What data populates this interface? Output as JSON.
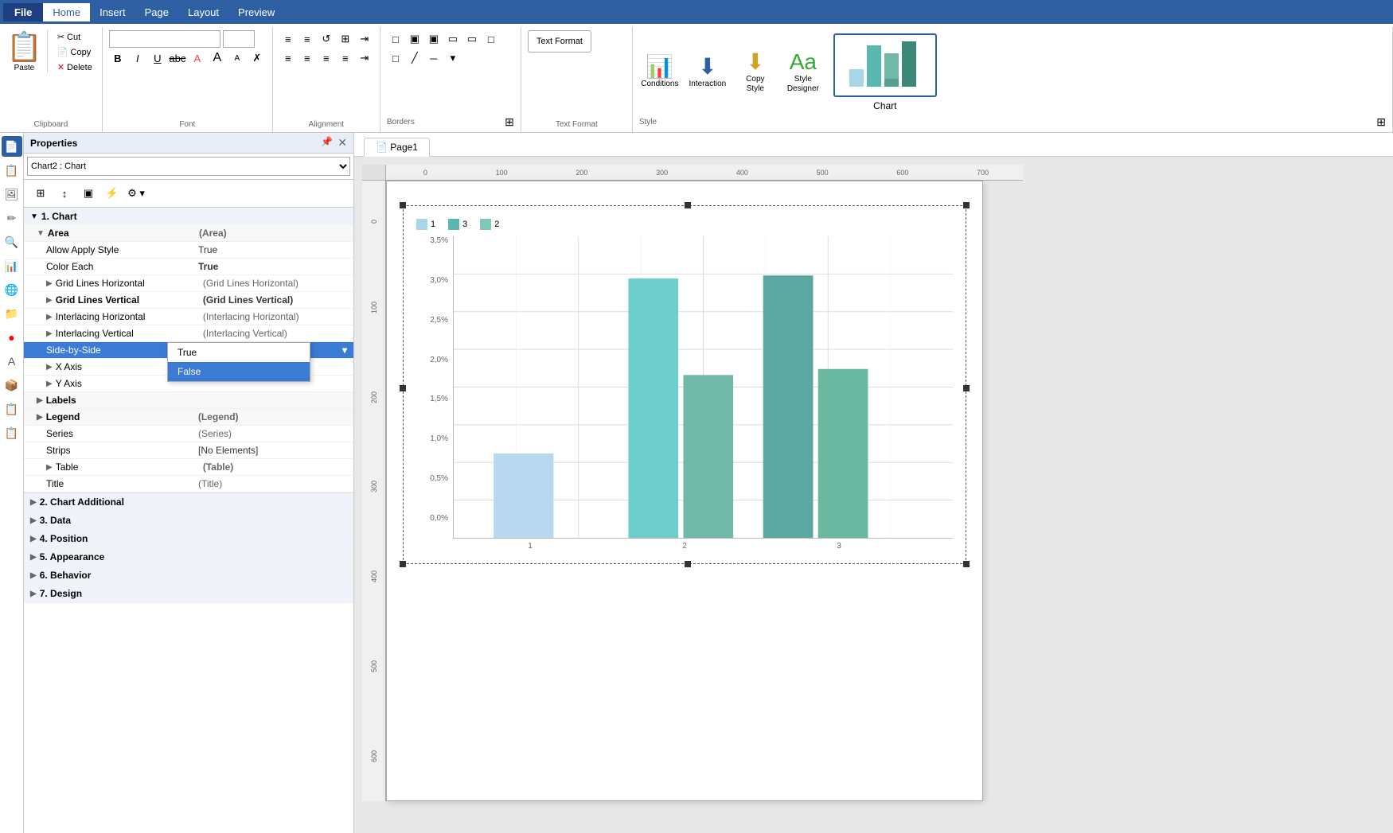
{
  "menu": {
    "file_label": "File",
    "items": [
      "Home",
      "Insert",
      "Page",
      "Layout",
      "Preview"
    ],
    "active": "Home"
  },
  "ribbon": {
    "clipboard": {
      "label": "Clipboard",
      "paste": "Paste",
      "cut": "Cut",
      "copy": "Copy",
      "delete": "Delete"
    },
    "font": {
      "label": "Font",
      "font_name": "",
      "font_size": "",
      "bold": "B",
      "italic": "I",
      "underline": "U",
      "strikethrough": "abc",
      "font_color": "A",
      "grow": "A",
      "shrink": "A",
      "clear": "✗"
    },
    "alignment": {
      "label": "Alignment",
      "expand_icon": "⊞"
    },
    "borders": {
      "label": "Borders",
      "text_format_btn": "Text Format",
      "expand_icon": "⊞"
    },
    "text_format": {
      "label": "Text Format",
      "btn": "Text Format"
    },
    "style": {
      "label": "Style",
      "conditions": "Conditions",
      "interaction": "Interaction",
      "copy_style": "Copy\nStyle",
      "style_designer": "Style\nDesigner",
      "expand_icon": "⊞"
    },
    "chart": {
      "label": "Chart"
    }
  },
  "properties": {
    "panel_title": "Properties",
    "selector_value": "Chart2 : Chart",
    "tree": {
      "section1": "1. Chart",
      "area_label": "Area",
      "area_value": "(Area)",
      "allow_apply_style_key": "Allow Apply Style",
      "allow_apply_style_val": "True",
      "color_each_key": "Color Each",
      "color_each_val": "True",
      "grid_lines_h_key": "Grid Lines Horizontal",
      "grid_lines_h_val": "(Grid Lines Horizontal)",
      "grid_lines_v_key": "Grid Lines Vertical",
      "grid_lines_v_val": "(Grid Lines Vertical)",
      "interlacing_h_key": "Interlacing Horizontal",
      "interlacing_h_val": "(Interlacing Horizontal)",
      "interlacing_v_key": "Interlacing Vertical",
      "interlacing_v_val": "(Interlacing Vertical)",
      "side_by_side_key": "Side-by-Side",
      "side_by_side_val": "False",
      "x_axis_key": "X Axis",
      "x_axis_val": "",
      "y_axis_key": "Y Axis",
      "y_axis_val": "",
      "labels_key": "Labels",
      "labels_val": "",
      "legend_key": "Legend",
      "legend_val": "(Legend)",
      "series_key": "Series",
      "series_val": "(Series)",
      "strips_key": "Strips",
      "strips_val": "[No Elements]",
      "table_key": "Table",
      "table_val": "(Table)",
      "title_key": "Title",
      "title_val": "(Title)",
      "section2": "2. Chart Additional",
      "section3": "3. Data",
      "section4": "4. Position",
      "section5": "5. Appearance",
      "section6": "6. Behavior",
      "section7": "7. Design"
    },
    "dropdown": {
      "true_option": "True",
      "false_option": "False",
      "selected": "False"
    }
  },
  "canvas": {
    "tab": "Page1",
    "ruler": {
      "h_ticks": [
        "100",
        "200",
        "300",
        "400",
        "500",
        "600",
        "700"
      ],
      "v_ticks": [
        "100",
        "200",
        "300",
        "400",
        "500",
        "600"
      ]
    }
  },
  "chart": {
    "legend": [
      {
        "label": "1",
        "color": "#a8d8e8"
      },
      {
        "label": "3",
        "color": "#5bb8b0"
      },
      {
        "label": "2",
        "color": "#80c8b8"
      }
    ],
    "yaxis_labels": [
      "3,5%",
      "3,0%",
      "2,5%",
      "2,0%",
      "1,5%",
      "1,0%",
      "0,5%",
      "0,0%"
    ],
    "xaxis_labels": [
      "1",
      "2",
      "3"
    ],
    "bars": [
      {
        "group": "1",
        "values": [
          {
            "height_pct": 28,
            "color": "#b8d8f0",
            "series": "1"
          }
        ]
      },
      {
        "group": "2",
        "values": [
          {
            "height_pct": 85,
            "color": "#6ecece",
            "series": "3"
          },
          {
            "height_pct": 55,
            "color": "#70b8a8",
            "series": "2"
          }
        ]
      },
      {
        "group": "3",
        "values": [
          {
            "height_pct": 87,
            "color": "#5aa8a0",
            "series": "3"
          },
          {
            "height_pct": 56,
            "color": "#6ab8a0",
            "series": "2"
          }
        ]
      }
    ]
  },
  "sidebar_icons": [
    "📄",
    "📋",
    "🖼",
    "✏",
    "🔍",
    "📊",
    "🌐",
    "📁",
    "🔴",
    "A",
    "📦",
    "📋",
    "📋"
  ]
}
